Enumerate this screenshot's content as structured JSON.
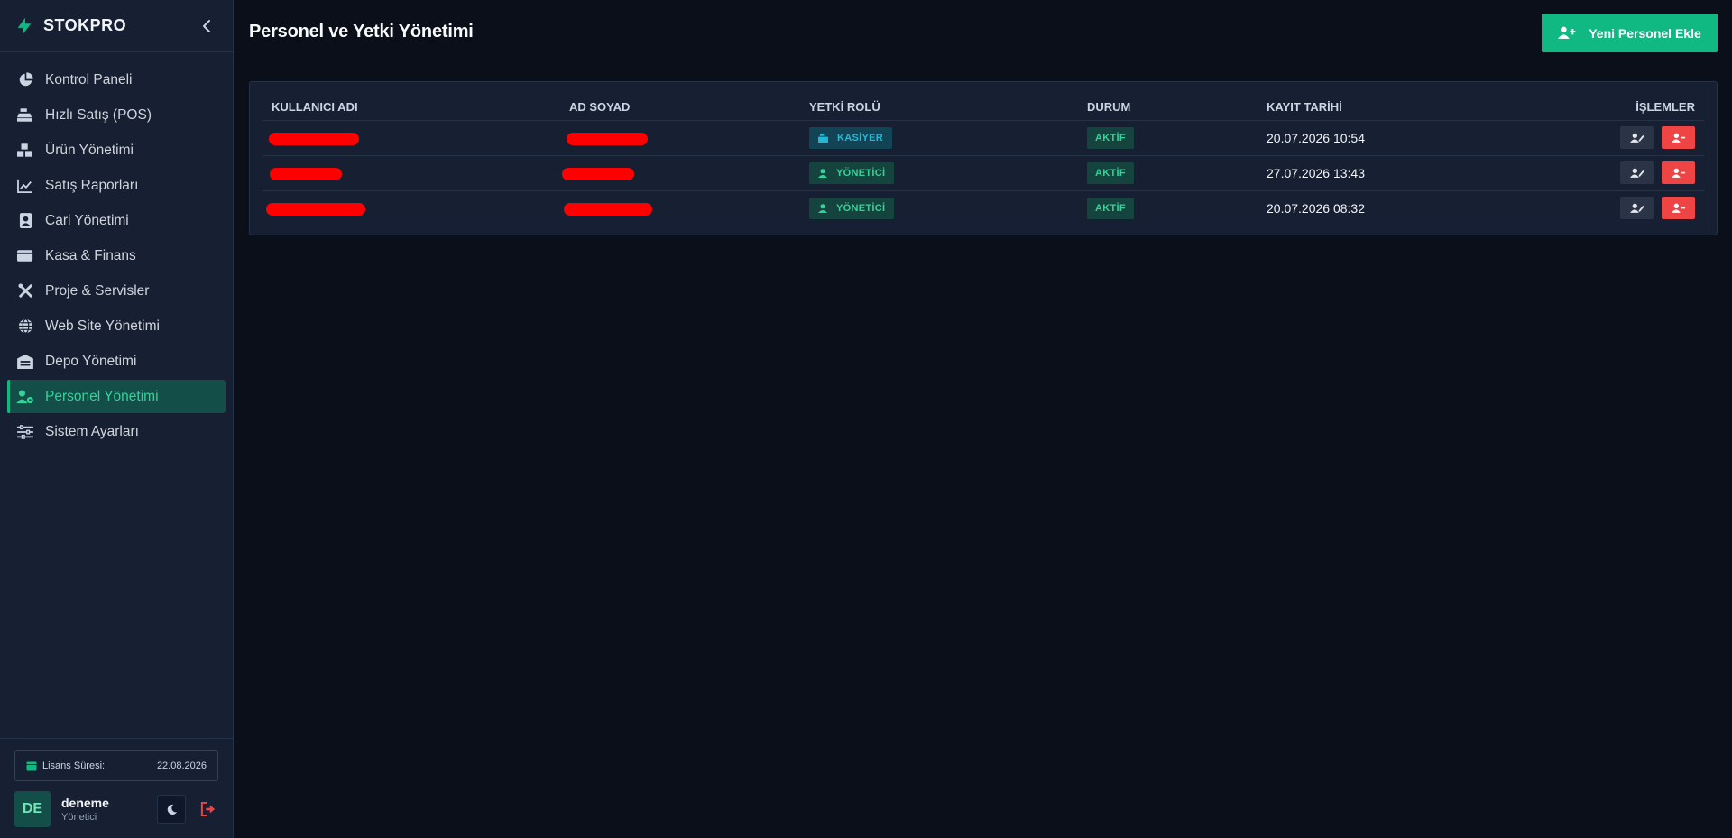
{
  "brand": {
    "name": "STOKPRO"
  },
  "sidebar": {
    "items": [
      {
        "label": "Kontrol Paneli",
        "icon": "pie-chart-icon"
      },
      {
        "label": "Hızlı Satış (POS)",
        "icon": "cash-register-icon"
      },
      {
        "label": "Ürün Yönetimi",
        "icon": "boxes-icon"
      },
      {
        "label": "Satış Raporları",
        "icon": "line-chart-icon"
      },
      {
        "label": "Cari Yönetimi",
        "icon": "contact-book-icon"
      },
      {
        "label": "Kasa & Finans",
        "icon": "wallet-icon"
      },
      {
        "label": "Proje & Servisler",
        "icon": "tools-icon"
      },
      {
        "label": "Web Site Yönetimi",
        "icon": "globe-icon"
      },
      {
        "label": "Depo Yönetimi",
        "icon": "warehouse-icon"
      },
      {
        "label": "Personel Yönetimi",
        "icon": "user-gear-icon",
        "active": true
      },
      {
        "label": "Sistem Ayarları",
        "icon": "sliders-icon"
      }
    ],
    "license": {
      "label": "Lisans Süresi:",
      "date": "22.08.2026"
    },
    "user": {
      "initials": "DE",
      "name": "deneme",
      "role": "Yönetici"
    }
  },
  "main": {
    "title": "Personel ve Yetki Yönetimi",
    "add_button": "Yeni Personel Ekle",
    "table": {
      "headers": {
        "username": "KULLANICI ADI",
        "fullname": "AD SOYAD",
        "role": "YETKİ ROLÜ",
        "status": "DURUM",
        "date": "KAYIT TARİHİ",
        "actions": "İŞLEMLER"
      },
      "rows": [
        {
          "role": "KASİYER",
          "role_type": "kasiyer",
          "status": "AKTİF",
          "date": "20.07.2026 10:54"
        },
        {
          "role": "YÖNETİCİ",
          "role_type": "yonetici",
          "status": "AKTİF",
          "date": "27.07.2026 13:43"
        },
        {
          "role": "YÖNETİCİ",
          "role_type": "yonetici",
          "status": "AKTİF",
          "date": "20.07.2026 08:32"
        }
      ]
    }
  },
  "colors": {
    "accent": "#10b981",
    "danger": "#ef4444",
    "background": "#0b0f19",
    "sidebar": "#172033"
  }
}
